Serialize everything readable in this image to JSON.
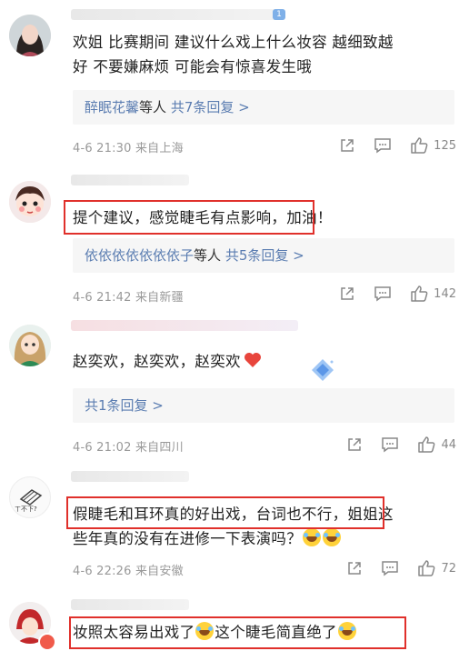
{
  "comments": [
    {
      "username": "",
      "text_line1": "欢姐 比赛期间 建议什么戏上什么妆容  越细致越",
      "text_line2": "好 不要嫌麻烦 可能会有惊喜发生哦",
      "replies": {
        "names": "醉眠花馨",
        "mid": "等人",
        "count": "共7条回复 >"
      },
      "date": "4-6 21:30",
      "location": "来自上海",
      "likes": "125"
    },
    {
      "text": "提个建议，感觉睫毛有点影响，",
      "text_tail": "加油！",
      "replies": {
        "names": "依依依依依依依子",
        "mid": "等人",
        "count": "共5条回复 >"
      },
      "date": "4-6 21:42",
      "location": "来自新疆",
      "likes": "142"
    },
    {
      "text": "赵奕欢，赵奕欢，赵奕欢",
      "replies": {
        "count": "共1条回复 >"
      },
      "date": "4-6 21:02",
      "location": "来自四川",
      "likes": "44"
    },
    {
      "text_line1_hl": "假睫毛和耳环真的好出戏，台词也不行，",
      "text_line1_tail": "姐姐这",
      "text_line2": "些年真的没有在进修一下表演吗？",
      "avatar_text": "ㄒ不下?",
      "date": "4-6 22:26",
      "location": "来自安徽",
      "likes": "72"
    },
    {
      "text_a": "妆照太容易出戏了",
      "text_b": "这个睫毛简直绝了"
    }
  ],
  "icons": {
    "share": "share-icon",
    "comment": "comment-icon",
    "like": "thumbs-up-icon",
    "emoji": "laughing-tears-emoji",
    "heart": "red-heart-emoji",
    "diamond": "diamond-badge-icon"
  },
  "colors": {
    "link": "#5b7db1",
    "highlight": "#e0302b",
    "meta": "#999999"
  }
}
